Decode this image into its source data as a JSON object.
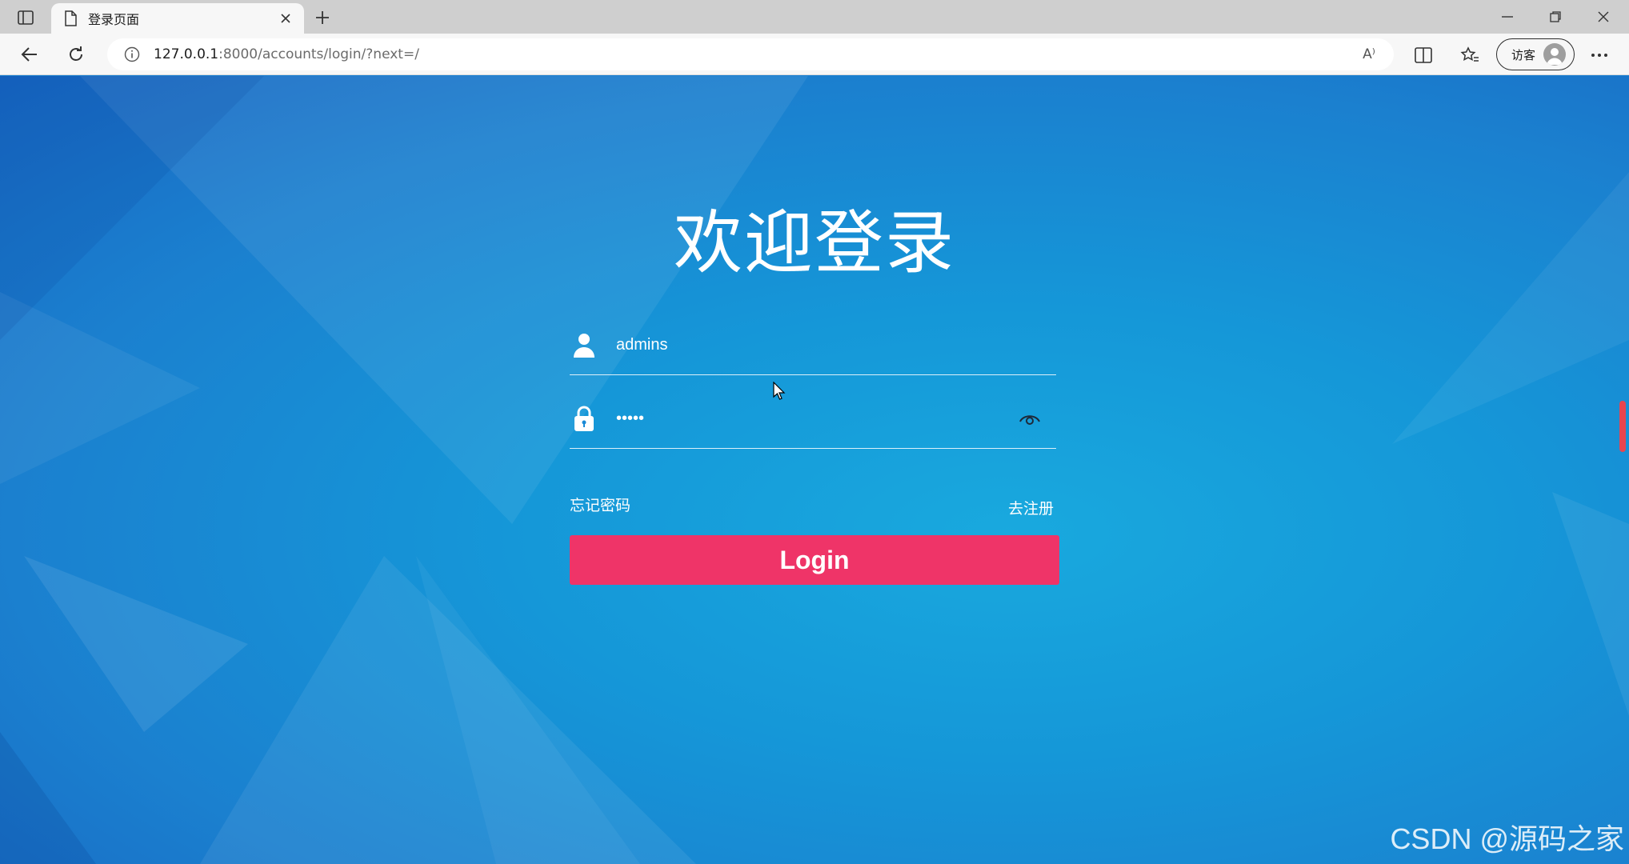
{
  "browser": {
    "tab_title": "登录页面",
    "url_host": "127.0.0.1",
    "url_path": ":8000/accounts/login/?next=/",
    "profile_label": "访客",
    "read_aloud": "A⁾"
  },
  "login": {
    "title": "欢迎登录",
    "username_value": "admins",
    "password_value": "•••••",
    "forgot_password": "忘记密码",
    "register": "去注册",
    "login_button": "Login"
  },
  "colors": {
    "button": "#ef3468",
    "background": "#1597d8"
  },
  "watermark": "CSDN @源码之家"
}
